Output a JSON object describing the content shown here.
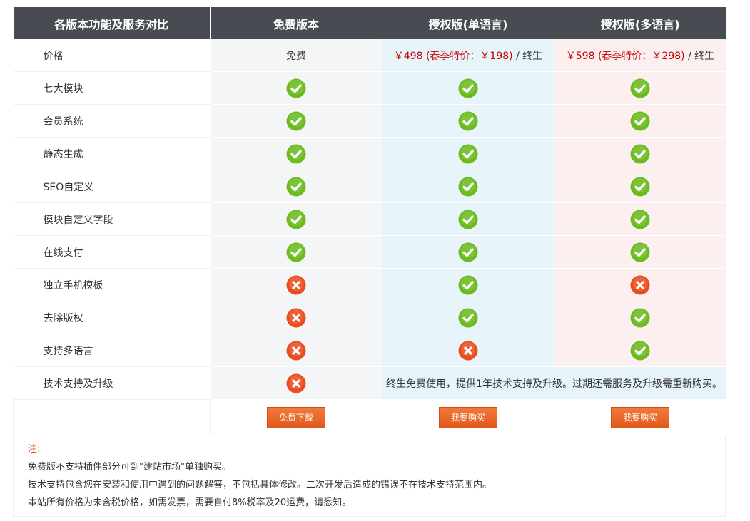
{
  "header": {
    "col0": "各版本功能及服务对比",
    "col1": "免费版本",
    "col2": "授权版(单语言)",
    "col3": "授权版(多语言)"
  },
  "price_row": {
    "label": "价格",
    "free": "免费",
    "single_old": "￥498",
    "single_sale": "(春季特价：￥198)",
    "single_term": "/ 终生",
    "multi_old": "￥598",
    "multi_sale": "(春季特价：￥298)",
    "multi_term": "/ 终生"
  },
  "features": [
    {
      "label": "七大模块",
      "free": true,
      "single": true,
      "multi": true
    },
    {
      "label": "会员系统",
      "free": true,
      "single": true,
      "multi": true
    },
    {
      "label": "静态生成",
      "free": true,
      "single": true,
      "multi": true
    },
    {
      "label": "SEO自定义",
      "free": true,
      "single": true,
      "multi": true
    },
    {
      "label": "模块自定义字段",
      "free": true,
      "single": true,
      "multi": true
    },
    {
      "label": "在线支付",
      "free": true,
      "single": true,
      "multi": true
    },
    {
      "label": "独立手机模板",
      "free": false,
      "single": true,
      "multi": false
    },
    {
      "label": "去除版权",
      "free": false,
      "single": true,
      "multi": true
    },
    {
      "label": "支持多语言",
      "free": false,
      "single": false,
      "multi": true
    }
  ],
  "support_row": {
    "label": "技术支持及升级",
    "free": false,
    "paid_text": "终生免费使用，提供1年技术支持及升级。过期还需服务及升级需重新购买。"
  },
  "buttons": {
    "free": "免费下载",
    "single": "我要购买",
    "multi": "我要购买"
  },
  "notes": {
    "title": "注:",
    "line1": "免费版不支持插件部分可到\"建站市场\"单独购买。",
    "line2": "技术支持包含您在安装和使用中遇到的问题解答，不包括具体修改。二次开发后造成的错误不在技术支持范围内。",
    "line3": "本站所有价格为未含税价格，如需发票，需要自付8%税率及20运费，请悉知。"
  },
  "colors": {
    "header_bg": "#484c52",
    "check": "#6cbb1e",
    "cross": "#e84c1f",
    "button": "#e2581b",
    "price_red": "#c40000"
  },
  "icons": {
    "yes": "check-icon",
    "no": "cross-icon"
  }
}
